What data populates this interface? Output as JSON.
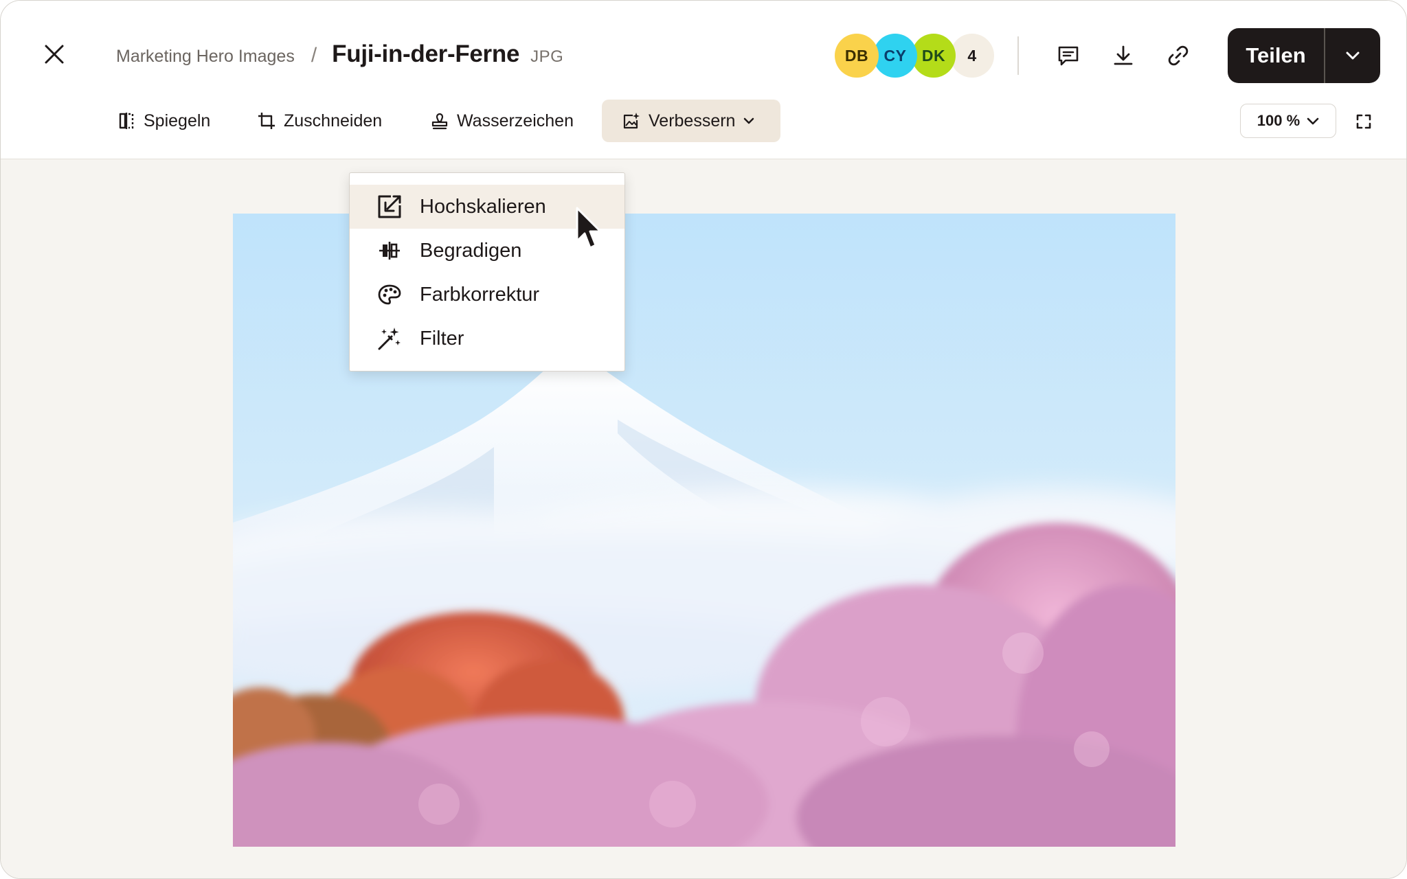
{
  "header": {
    "breadcrumb_parent": "Marketing Hero Images",
    "breadcrumb_separator": "/",
    "file_title": "Fuji-in-der-Ferne",
    "file_type": "JPG"
  },
  "collaborators": [
    {
      "initials": "DB",
      "color": "#fad24b",
      "text_color": "#3b2e00"
    },
    {
      "initials": "CY",
      "color": "#2fd2f0",
      "text_color": "#0a3e6b"
    },
    {
      "initials": "DK",
      "color": "#b4dc19",
      "text_color": "#1f4a1a"
    }
  ],
  "collaborator_overflow": {
    "count": "4",
    "color": "#f4eee4"
  },
  "share": {
    "label": "Teilen"
  },
  "toolbar": {
    "mirror": "Spiegeln",
    "crop": "Zuschneiden",
    "watermark": "Wasserzeichen",
    "enhance": "Verbessern"
  },
  "zoom": {
    "value": "100 %"
  },
  "enhance_menu": {
    "items": [
      {
        "label": "Hochskalieren",
        "icon": "upscale-icon",
        "active": true
      },
      {
        "label": "Begradigen",
        "icon": "straighten-icon",
        "active": false
      },
      {
        "label": "Farbkorrektur",
        "icon": "palette-icon",
        "active": false
      },
      {
        "label": "Filter",
        "icon": "magic-wand-icon",
        "active": false
      }
    ]
  },
  "colors": {
    "accent_dark": "#1e1919",
    "enhance_bg": "#efe7dc",
    "canvas_bg": "#f6f4f0"
  }
}
